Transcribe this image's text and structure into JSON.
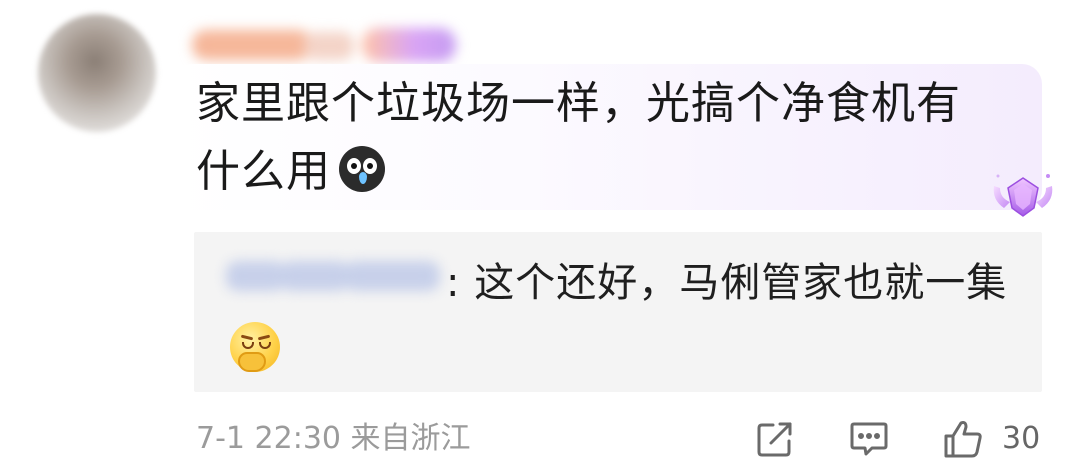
{
  "comment": {
    "text": "家里跟个垃圾场一样，光搞个净食机有什么用"
  },
  "reply": {
    "separator": ":",
    "text": " 这个还好，马俐管家也就一集"
  },
  "footer": {
    "time": "7-1 22:30",
    "location": "来自浙江",
    "like_count": "30"
  },
  "icons": {
    "comment_emoji": "crying-face-emoji",
    "reply_emoji": "smirk-face-emoji",
    "badge": "purple-gem-badge",
    "share": "share-icon",
    "reply_action": "comment-icon",
    "like": "thumbs-up-icon"
  },
  "colors": {
    "text": "#1a1a1a",
    "meta": "#9b9b9b",
    "reply_bg": "#f4f4f4",
    "accent": "#b070f0"
  }
}
